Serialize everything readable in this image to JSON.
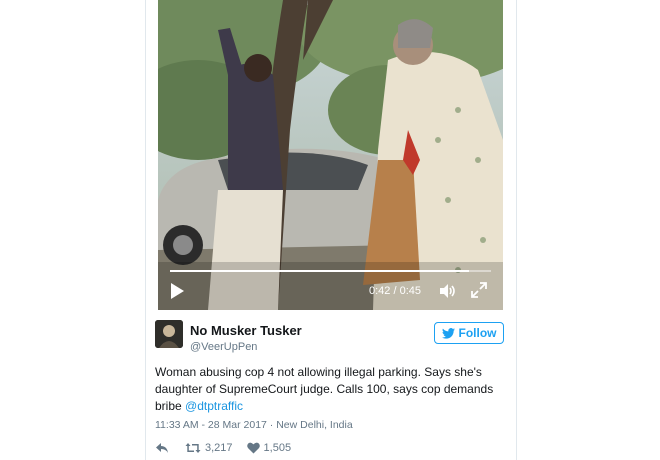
{
  "video": {
    "time": "0:42 / 0:45",
    "progress": 0.93,
    "icons": [
      "play-icon",
      "volume-icon",
      "fullscreen-icon"
    ]
  },
  "author": {
    "name": "No Musker Tusker",
    "handle": "@VeerUpPen"
  },
  "follow_button": {
    "label": "Follow",
    "icon": "twitter-bird-icon",
    "color": "#1da1f2"
  },
  "tweet": {
    "text": "Woman abusing cop 4 not allowing illegal parking. Says she's daughter of SupremeCourt judge. Calls 100, says cop demands bribe",
    "mention": "@dtptraffic",
    "timestamp": "11:33 AM - 28 Mar 2017",
    "separator": "·",
    "location": "New Delhi, India"
  },
  "actions": {
    "retweets": "3,217",
    "likes": "1,505",
    "icons": [
      "reply-icon",
      "retweet-icon",
      "heart-icon"
    ]
  },
  "colors": {
    "link": "#1b95e0",
    "text": "#14171a",
    "muted": "#657786"
  }
}
